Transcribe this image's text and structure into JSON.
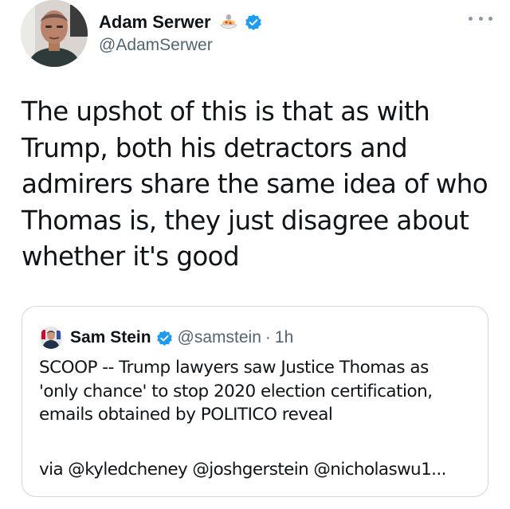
{
  "tweet": {
    "author": {
      "display_name": "Adam Serwer",
      "handle": "@AdamSerwer",
      "name_emoji_icon": "spaghetti-icon",
      "verified_icon": "verified-badge-icon"
    },
    "more_icon": "more-options-icon",
    "text": "The upshot of this is that as with Trump, both his detractors and admirers share the same idea of who Thomas is, they just disagree about whether it's good",
    "text_lines": [
      "The upshot of this is that as with",
      "Trump, both his detractors and",
      "admirers share the same idea of who",
      "Thomas is, they just disagree about",
      "whether it's good"
    ]
  },
  "quote": {
    "author": {
      "display_name": "Sam Stein",
      "handle": "@samstein",
      "separator": "·",
      "time": "1h",
      "verified_icon": "verified-badge-icon"
    },
    "body_lines": [
      "SCOOP -- Trump lawyers saw Justice Thomas as",
      "'only chance' to stop 2020 election certification,",
      "emails obtained by POLITICO reveal"
    ],
    "via_text": "via @kyledcheney @joshgerstein @nicholaswu1..."
  },
  "colors": {
    "text_primary": "#0f1419",
    "text_secondary": "#536471",
    "verified_blue": "#1d9bf0",
    "border": "#cfd9de"
  }
}
